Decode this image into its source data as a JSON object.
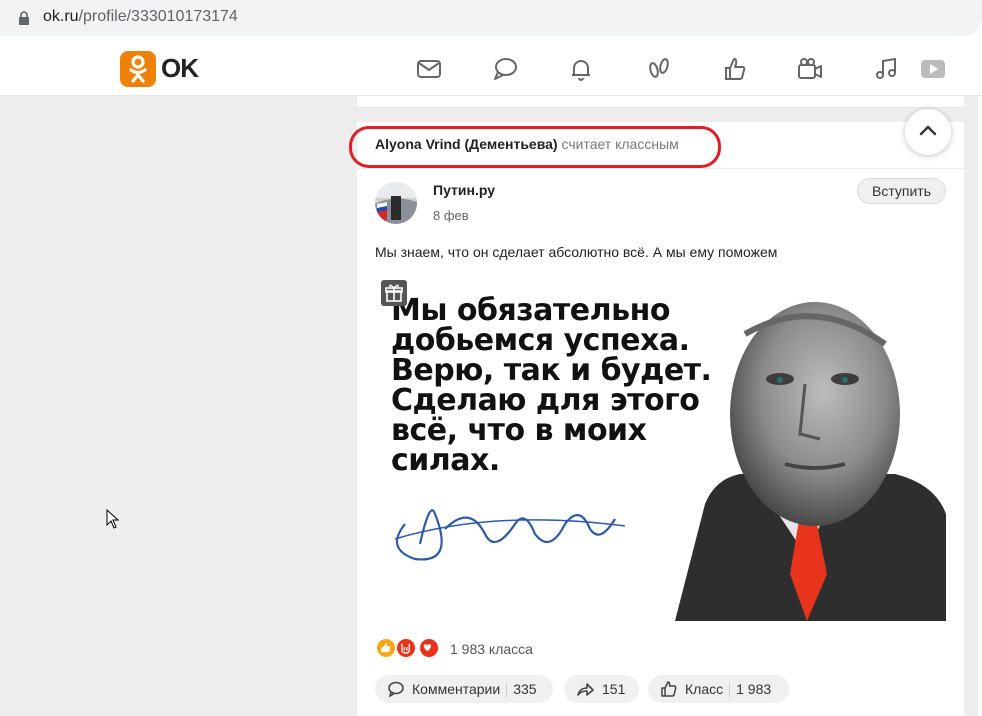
{
  "browser": {
    "url_host": "ok.ru",
    "url_path": "/profile/333010173174"
  },
  "header": {
    "logo_text": "OK",
    "nav_icons": [
      "mail-icon",
      "discussions-icon",
      "notifications-icon",
      "guests-icon",
      "likes-icon",
      "video-icon",
      "music-icon",
      "play-icon"
    ]
  },
  "colors": {
    "brand_orange": "#ee8208",
    "highlight_red": "#e01e26",
    "page_bg": "#ededed"
  },
  "feed_item": {
    "liker_name": "Alyona Vrind (Дементьева)",
    "liker_action": "считает классным",
    "group_name": "Путин.ру",
    "post_date": "8 фев",
    "join_label": "Вступить",
    "post_text": "Мы знаем, что он сделает абсолютно всё. А мы ему поможем",
    "image_quote": [
      "Мы обязательно",
      "добьемся успеха.",
      "Верю, так и будет.",
      "Сделаю для этого",
      "всё, что в моих",
      "силах."
    ],
    "reactions_count": "1 983 класса",
    "actions": {
      "comments_label": "Комментарии",
      "comments_count": "335",
      "share_count": "151",
      "class_label": "Класс",
      "class_count": "1 983"
    }
  }
}
